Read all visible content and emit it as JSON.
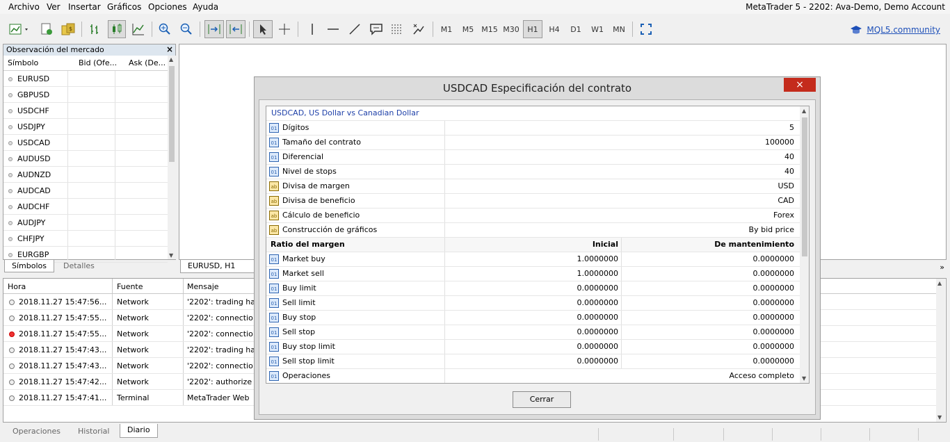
{
  "menu": [
    "Archivo",
    "Ver",
    "Insertar",
    "Gráficos",
    "Opciones",
    "Ayuda"
  ],
  "window_title": "MetaTrader 5 - 2202: Ava-Demo, Demo Account",
  "toolbar": {
    "timeframes": [
      "M1",
      "M5",
      "M15",
      "M30",
      "H1",
      "H4",
      "D1",
      "W1",
      "MN"
    ],
    "active_timeframe": "H1",
    "mql_link": "MQL5.community"
  },
  "market_watch": {
    "title": "Observación del mercado",
    "col_symbol": "Símbolo",
    "col_bid": "Bid (Ofe...",
    "col_ask": "Ask (De...",
    "symbols": [
      "EURUSD",
      "GBPUSD",
      "USDCHF",
      "USDJPY",
      "USDCAD",
      "AUDUSD",
      "AUDNZD",
      "AUDCAD",
      "AUDCHF",
      "AUDJPY",
      "CHFJPY",
      "EURGBP"
    ],
    "tabs": [
      "Símbolos",
      "Detalles"
    ],
    "close": "×"
  },
  "chart": {
    "tab": "EURUSD, H1",
    "arrow": "»"
  },
  "journal": {
    "columns": [
      "Hora",
      "Fuente",
      "Mensaje"
    ],
    "rows": [
      {
        "time": "2018.11.27 15:47:56...",
        "source": "Network",
        "message": "'2202': trading ha",
        "error": false
      },
      {
        "time": "2018.11.27 15:47:55...",
        "source": "Network",
        "message": "'2202': connectio",
        "error": false
      },
      {
        "time": "2018.11.27 15:47:55...",
        "source": "Network",
        "message": "'2202': connectio",
        "error": true
      },
      {
        "time": "2018.11.27 15:47:43...",
        "source": "Network",
        "message": "'2202': trading ha",
        "error": false
      },
      {
        "time": "2018.11.27 15:47:43...",
        "source": "Network",
        "message": "'2202': connectio",
        "error": false
      },
      {
        "time": "2018.11.27 15:47:42...",
        "source": "Network",
        "message": "'2202': authorize",
        "error": false
      },
      {
        "time": "2018.11.27 15:47:41...",
        "source": "Terminal",
        "message": "MetaTrader Web",
        "error": false
      }
    ],
    "tabs": [
      "Operaciones",
      "Historial",
      "Diario"
    ],
    "active_tab": "Diario"
  },
  "dialog": {
    "title": "USDCAD Especificación del contrato",
    "close": "×",
    "subtitle": "USDCAD, US Dollar vs Canadian Dollar",
    "props": [
      {
        "label": "Dígitos",
        "value": "5",
        "icon": "01"
      },
      {
        "label": "Tamaño del contrato",
        "value": "100000",
        "icon": "01"
      },
      {
        "label": "Diferencial",
        "value": "40",
        "icon": "01"
      },
      {
        "label": "Nivel de stops",
        "value": "40",
        "icon": "01"
      },
      {
        "label": "Divisa de margen",
        "value": "USD",
        "icon": "ab"
      },
      {
        "label": "Divisa de beneficio",
        "value": "CAD",
        "icon": "ab"
      },
      {
        "label": "Cálculo de beneficio",
        "value": "Forex",
        "icon": "ab"
      },
      {
        "label": "Construcción de gráficos",
        "value": "By bid price",
        "icon": "ab"
      }
    ],
    "margin_header": {
      "label": "Ratio del margen",
      "initial": "Inicial",
      "maintenance": "De mantenimiento"
    },
    "margins": [
      {
        "label": "Market buy",
        "initial": "1.0000000",
        "maintenance": "0.0000000"
      },
      {
        "label": "Market sell",
        "initial": "1.0000000",
        "maintenance": "0.0000000"
      },
      {
        "label": "Buy limit",
        "initial": "0.0000000",
        "maintenance": "0.0000000"
      },
      {
        "label": "Sell limit",
        "initial": "0.0000000",
        "maintenance": "0.0000000"
      },
      {
        "label": "Buy stop",
        "initial": "0.0000000",
        "maintenance": "0.0000000"
      },
      {
        "label": "Sell stop",
        "initial": "0.0000000",
        "maintenance": "0.0000000"
      },
      {
        "label": "Buy stop limit",
        "initial": "0.0000000",
        "maintenance": "0.0000000"
      },
      {
        "label": "Sell stop limit",
        "initial": "0.0000000",
        "maintenance": "0.0000000"
      }
    ],
    "operations": {
      "label": "Operaciones",
      "value": "Acceso completo"
    },
    "button": "Cerrar"
  }
}
